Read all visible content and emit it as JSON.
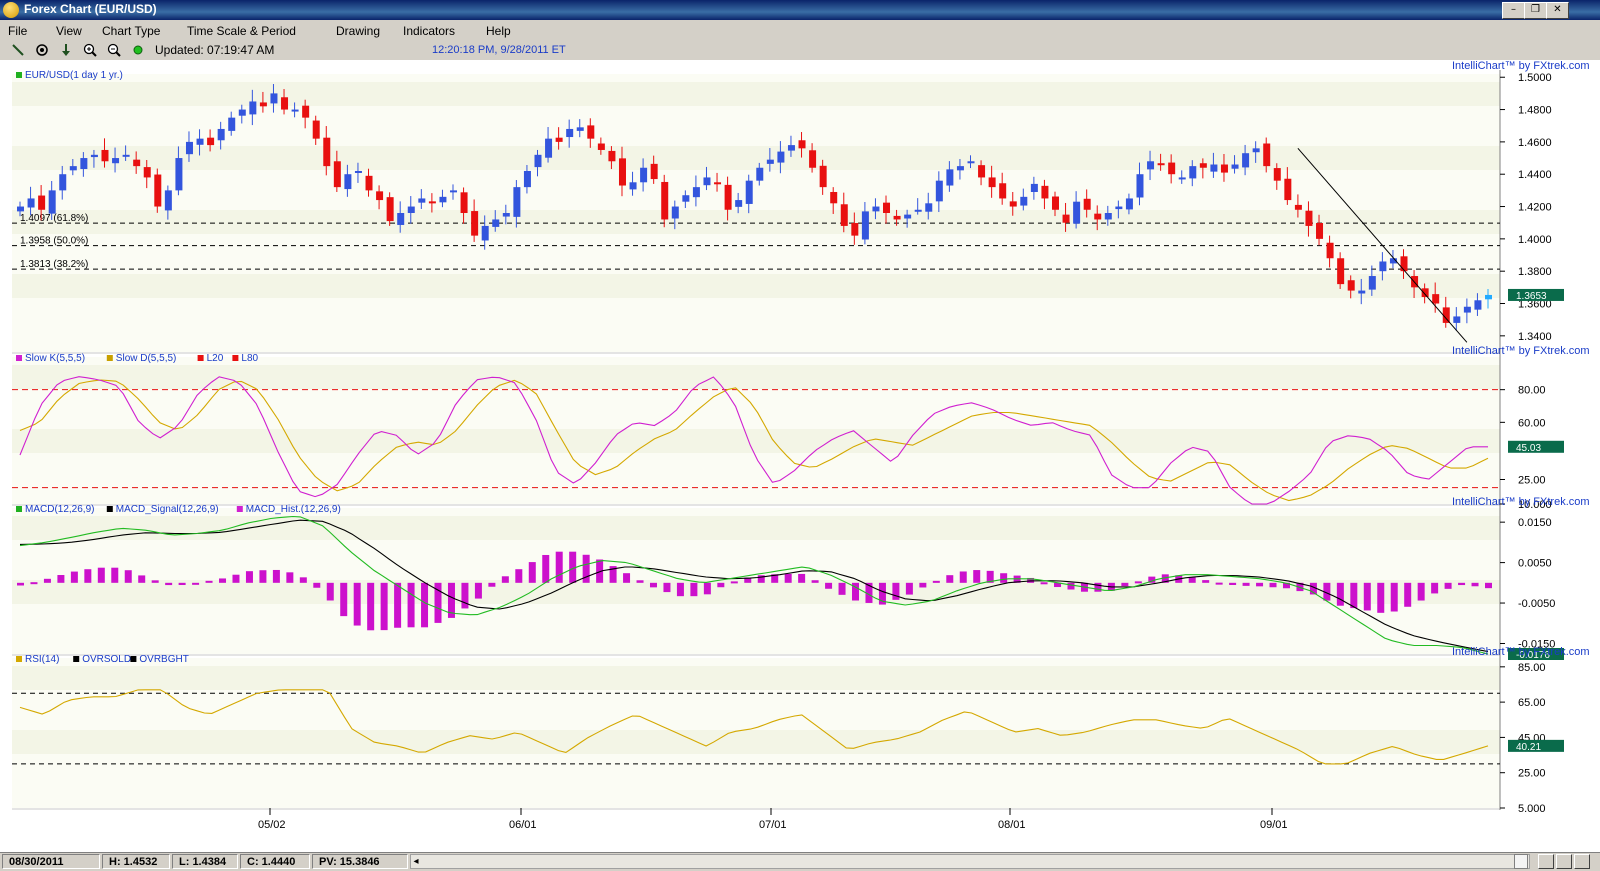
{
  "window": {
    "title": "Forex Chart (EUR/USD)"
  },
  "menu": [
    "File",
    "View",
    "Chart Type",
    "Time Scale & Period",
    "Drawing",
    "Indicators",
    "Help"
  ],
  "toolbar": {
    "updated": "Updated: 07:19:47 AM",
    "clock": "12:20:18 PM, 9/28/2011 ET",
    "icons": [
      "line-draw-icon",
      "target-icon",
      "download-arrow-icon",
      "zoom-in-icon",
      "zoom-out-icon",
      "live-status-icon"
    ]
  },
  "branding": "IntelliChart™ by FXtrek.com",
  "colors": {
    "up": "#3355dd",
    "down": "#e81010",
    "last_up": "#22aaff",
    "value_tag": "#0a6b4b",
    "band": "#f3f5e6"
  },
  "chart_data": [
    {
      "type": "candlestick",
      "legend": "EUR/USD(1 day  1 yr.)",
      "ylim": [
        1.33,
        1.502
      ],
      "y_ticks": [
        "1.5000",
        "1.4800",
        "1.4600",
        "1.4400",
        "1.4200",
        "1.4000",
        "1.3800",
        "1.3600",
        "1.3400"
      ],
      "last_value": "1.3653",
      "fib_levels": [
        {
          "label": "1.4097 (61.8%)",
          "value": 1.4097
        },
        {
          "label": "1.3958 (50.0%)",
          "value": 1.3958
        },
        {
          "label": "1.3813 (38.2%)",
          "value": 1.3813
        }
      ],
      "trendline": {
        "from": [
          1.456
        ],
        "to": [
          1.336
        ]
      },
      "close_key": [
        1.42,
        1.425,
        1.418,
        1.43,
        1.44,
        1.445,
        1.45,
        1.452,
        1.448,
        1.45,
        1.452,
        1.445,
        1.438,
        1.42,
        1.43,
        1.45,
        1.46,
        1.462,
        1.458,
        1.468,
        1.475,
        1.48,
        1.485,
        1.482,
        1.49,
        1.48,
        1.48,
        1.475,
        1.462,
        1.445,
        1.432,
        1.44,
        1.442,
        1.43,
        1.424,
        1.411,
        1.416,
        1.42,
        1.425,
        1.422,
        1.426,
        1.43,
        1.416,
        1.402,
        1.408,
        1.412,
        1.416,
        1.432,
        1.442,
        1.452,
        1.462,
        1.46,
        1.468,
        1.469,
        1.462,
        1.455,
        1.448,
        1.433,
        1.435,
        1.444,
        1.437,
        1.412,
        1.42,
        1.427,
        1.432,
        1.438,
        1.434,
        1.418,
        1.424,
        1.436,
        1.444,
        1.449,
        1.454,
        1.458,
        1.456,
        1.444,
        1.432,
        1.422,
        1.408,
        1.402,
        1.417,
        1.42,
        1.416,
        1.412,
        1.415,
        1.418,
        1.422,
        1.436,
        1.443,
        1.445,
        1.448,
        1.438,
        1.432,
        1.425,
        1.42,
        1.426,
        1.434,
        1.425,
        1.418,
        1.41,
        1.423,
        1.418,
        1.412,
        1.416,
        1.42,
        1.425,
        1.44,
        1.448,
        1.446,
        1.44,
        1.438,
        1.445,
        1.444,
        1.446,
        1.441,
        1.446,
        1.453,
        1.456,
        1.445,
        1.436,
        1.424,
        1.418,
        1.408,
        1.4,
        1.388,
        1.372,
        1.368,
        1.368,
        1.377,
        1.386,
        1.388,
        1.38,
        1.37,
        1.364,
        1.36,
        1.348,
        1.352,
        1.358,
        1.362,
        1.3653
      ]
    },
    {
      "type": "line",
      "legend": [
        "Slow K(5,5,5)",
        "Slow D(5,5,5)",
        "L20",
        "L80"
      ],
      "ylim": [
        10,
        100
      ],
      "y_ticks": [
        "80.00",
        "60.00",
        "25.00",
        "10.000"
      ],
      "last_value": "45.03",
      "levels": [
        20,
        80
      ],
      "k_key": [
        40,
        70,
        85,
        88,
        86,
        82,
        60,
        50,
        58,
        78,
        88,
        85,
        70,
        42,
        18,
        14,
        22,
        40,
        55,
        52,
        40,
        48,
        72,
        86,
        88,
        84,
        62,
        30,
        22,
        35,
        52,
        60,
        58,
        66,
        82,
        88,
        72,
        40,
        22,
        30,
        42,
        50,
        55,
        45,
        35,
        52,
        65,
        70,
        72,
        68,
        62,
        58,
        60,
        55,
        52,
        28,
        20,
        20,
        35,
        45,
        42,
        20,
        10,
        10,
        18,
        28,
        48,
        52,
        50,
        42,
        28,
        25,
        35,
        45,
        45
      ],
      "d_key": [
        55,
        60,
        75,
        84,
        86,
        85,
        74,
        60,
        55,
        65,
        80,
        86,
        80,
        62,
        40,
        25,
        18,
        22,
        35,
        45,
        48,
        46,
        55,
        70,
        82,
        86,
        78,
        56,
        35,
        28,
        32,
        42,
        50,
        55,
        66,
        76,
        82,
        70,
        48,
        35,
        32,
        38,
        45,
        50,
        48,
        46,
        52,
        58,
        64,
        66,
        66,
        64,
        62,
        60,
        58,
        48,
        36,
        26,
        24,
        30,
        36,
        34,
        24,
        16,
        12,
        15,
        22,
        32,
        40,
        46,
        44,
        38,
        32,
        32,
        38
      ]
    },
    {
      "type": "line+bar",
      "legend": [
        "MACD(12,26,9)",
        "MACD_Signal(12,26,9)",
        "MACD_Hist.(12,26,9)"
      ],
      "ylim": [
        -0.0176,
        0.0185
      ],
      "y_ticks": [
        "0.0150",
        "0.0050",
        "-0.0050",
        "-0.0150"
      ],
      "last_value": "-0.0176",
      "macd_key": [
        0.0092,
        0.01,
        0.0112,
        0.0125,
        0.0135,
        0.013,
        0.0118,
        0.0122,
        0.013,
        0.0148,
        0.016,
        0.0165,
        0.014,
        0.008,
        0.003,
        -0.001,
        -0.005,
        -0.0075,
        -0.008,
        -0.006,
        -0.003,
        0.001,
        0.004,
        0.0055,
        0.005,
        0.003,
        0.001,
        0.0,
        0.001,
        0.002,
        0.003,
        0.004,
        0.002,
        -0.001,
        -0.0045,
        -0.0055,
        -0.0045,
        -0.002,
        0.0,
        0.001,
        0.001,
        0.0,
        -0.001,
        -0.002,
        -0.001,
        0.001,
        0.002,
        0.002,
        0.0015,
        0.001,
        0.0,
        -0.002,
        -0.006,
        -0.01,
        -0.014,
        -0.0155,
        -0.0155,
        -0.016,
        -0.0176
      ],
      "signal_key": [
        0.0095,
        0.0096,
        0.01,
        0.0108,
        0.0118,
        0.0124,
        0.0122,
        0.0122,
        0.0125,
        0.0135,
        0.0145,
        0.0155,
        0.0152,
        0.0125,
        0.0085,
        0.004,
        0.0,
        -0.0035,
        -0.006,
        -0.0065,
        -0.005,
        -0.0025,
        0.0005,
        0.003,
        0.004,
        0.0035,
        0.0025,
        0.0015,
        0.001,
        0.0012,
        0.002,
        0.003,
        0.0028,
        0.001,
        -0.002,
        -0.004,
        -0.0045,
        -0.0032,
        -0.0015,
        0.0,
        0.0005,
        0.0005,
        0.0,
        -0.001,
        -0.001,
        0.0,
        0.0012,
        0.0018,
        0.0018,
        0.0014,
        0.0006,
        -0.0008,
        -0.0035,
        -0.007,
        -0.0105,
        -0.013,
        -0.0145,
        -0.0158,
        -0.017
      ]
    },
    {
      "type": "line",
      "legend": [
        "RSI(14)",
        "OVRSOLD",
        "OVRBGHT"
      ],
      "ylim": [
        5,
        90
      ],
      "y_ticks": [
        "85.00",
        "65.00",
        "45.00",
        "25.00",
        "5.000"
      ],
      "last_value": "40.21",
      "levels": [
        30,
        70
      ],
      "rsi_key": [
        62,
        58,
        66,
        68,
        68,
        72,
        72,
        62,
        58,
        64,
        70,
        72,
        72,
        72,
        50,
        42,
        40,
        36,
        42,
        46,
        44,
        48,
        42,
        36,
        45,
        52,
        58,
        52,
        46,
        40,
        48,
        50,
        55,
        58,
        48,
        38,
        42,
        44,
        48,
        55,
        60,
        54,
        48,
        50,
        46,
        48,
        52,
        55,
        55,
        52,
        50,
        56,
        50,
        44,
        38,
        30,
        30,
        36,
        40,
        35,
        32,
        36,
        40.21
      ]
    }
  ],
  "x_axis": {
    "ticks": [
      "05/02",
      "06/01",
      "07/01",
      "08/01",
      "09/01"
    ]
  },
  "status": {
    "date": "08/30/2011",
    "high": "H: 1.4532",
    "low": "L: 1.4384",
    "close": "C: 1.4440",
    "pv": "PV: 15.3846"
  }
}
